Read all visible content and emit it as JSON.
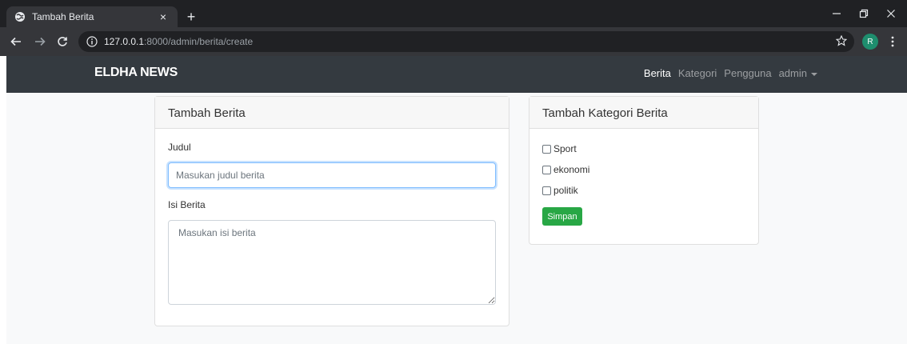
{
  "browser": {
    "tab_title": "Tambah Berita",
    "tab_close": "×",
    "new_tab": "+",
    "url_host": "127.0.0.1",
    "url_rest": ":8000/admin/berita/create",
    "profile_initial": "R"
  },
  "navbar": {
    "brand": "ELDHA NEWS",
    "links": [
      "Berita",
      "Kategori",
      "Pengguna"
    ],
    "user_menu": "admin"
  },
  "berita_card": {
    "header": "Tambah Berita",
    "judul_label": "Judul",
    "judul_placeholder": "Masukan judul berita",
    "isi_label": "Isi Berita",
    "isi_placeholder": "Masukan isi berita"
  },
  "kategori_card": {
    "header": "Tambah Kategori Berita",
    "options": [
      "Sport",
      "ekonomi",
      "politik"
    ],
    "submit_label": "Simpan"
  },
  "colors": {
    "navbar_bg": "#343a40",
    "submit_bg": "#28a745",
    "focus_border": "#80bdff"
  }
}
